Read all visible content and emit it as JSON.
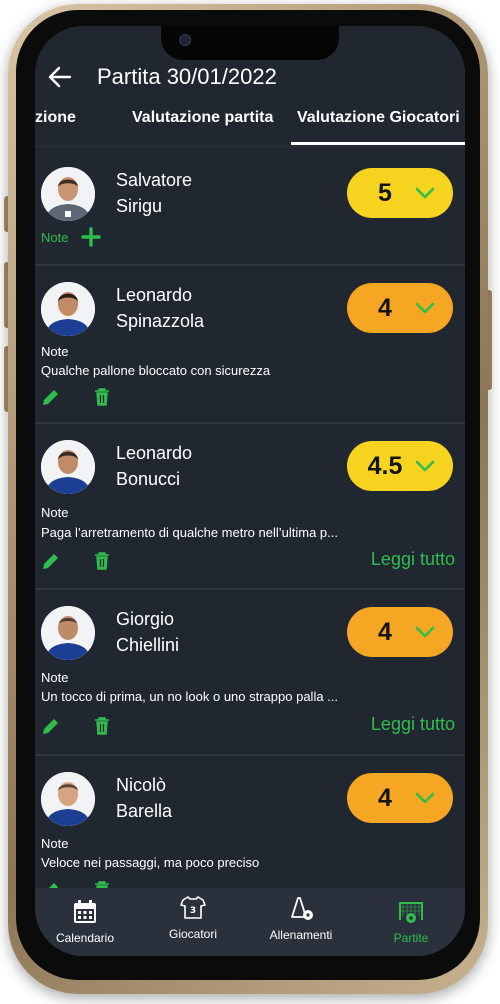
{
  "header": {
    "title": "Partita 30/01/2022"
  },
  "tabs": [
    {
      "label": "zione"
    },
    {
      "label": "Valutazione partita"
    },
    {
      "label": "Valutazione Giocatori"
    }
  ],
  "players": [
    {
      "first": "Salvatore",
      "last": "Sirigu",
      "rating": "5",
      "rating_color": "#f5d31f",
      "note_label": "Note",
      "note_text": ""
    },
    {
      "first": "Leonardo",
      "last": "Spinazzola",
      "rating": "4",
      "rating_color": "#f5a623",
      "note_label": "Note",
      "note_text": "Qualche pallone bloccato con sicurezza"
    },
    {
      "first": "Leonardo",
      "last": "Bonucci",
      "rating": "4.5",
      "rating_color": "#f5d31f",
      "note_label": "Note",
      "note_text": "Paga l’arretramento di qualche metro nell’ultima p...",
      "read_more": "Leggi tutto"
    },
    {
      "first": "Giorgio",
      "last": "Chiellini",
      "rating": "4",
      "rating_color": "#f5a623",
      "note_label": "Note",
      "note_text": "Un tocco di prima, un no look o uno strappo palla ...",
      "read_more": "Leggi tutto"
    },
    {
      "first": "Nicolò",
      "last": "Barella",
      "rating": "4",
      "rating_color": "#f5a623",
      "note_label": "Note",
      "note_text": "Veloce nei passaggi, ma poco preciso"
    }
  ],
  "bottom_nav": [
    {
      "label": "Calendario",
      "icon": "calendar-icon",
      "active": false
    },
    {
      "label": "Giocatori",
      "icon": "jersey-icon",
      "active": false
    },
    {
      "label": "Allenamenti",
      "icon": "training-icon",
      "active": false
    },
    {
      "label": "Partite",
      "icon": "goal-icon",
      "active": true
    }
  ],
  "colors": {
    "background": "#212731",
    "accent_green": "#2fbd4c",
    "rating_yellow": "#f5d31f",
    "rating_orange": "#f5a623",
    "nav_bg": "#2a313d"
  }
}
